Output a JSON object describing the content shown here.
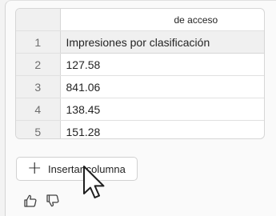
{
  "table": {
    "column_header": "de acceso",
    "rows": [
      {
        "num": "1",
        "value": "Impresiones por clasificación"
      },
      {
        "num": "2",
        "value": "127.58"
      },
      {
        "num": "3",
        "value": "841.06"
      },
      {
        "num": "4",
        "value": "138.45"
      },
      {
        "num": "5",
        "value": "151.28"
      }
    ]
  },
  "actions": {
    "insert_column_label": "Insertar columna",
    "insert_icon": "plus-icon"
  },
  "feedback": {
    "like_icon": "thumbs-up-icon",
    "dislike_icon": "thumbs-down-icon"
  },
  "colors": {
    "header_bg": "#f0f0f0",
    "border": "#d6d6d6",
    "text": "#242424",
    "row_number": "#6e6e6e"
  }
}
